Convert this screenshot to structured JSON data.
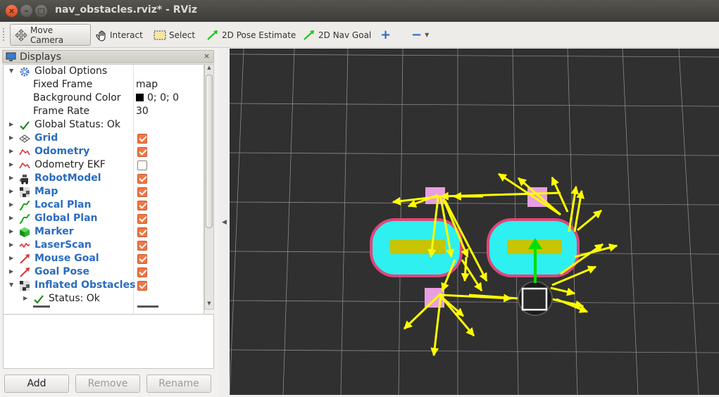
{
  "window": {
    "title": "nav_obstacles.rviz* - RViz",
    "close_glyph": "×",
    "minimize_glyph": "–",
    "maximize_glyph": "□"
  },
  "toolbar": {
    "tools": [
      {
        "label": "Move Camera",
        "icon": "move-camera-icon",
        "active": true
      },
      {
        "label": "Interact",
        "icon": "hand-icon",
        "active": false
      },
      {
        "label": "Select",
        "icon": "select-icon",
        "active": false
      },
      {
        "label": "2D Pose Estimate",
        "icon": "pose-estimate-arrow-icon",
        "active": false
      },
      {
        "label": "2D Nav Goal",
        "icon": "nav-goal-arrow-icon",
        "active": false
      }
    ],
    "add_glyph": "+",
    "remove_glyph": "−"
  },
  "displays": {
    "title": "Displays",
    "close_glyph": "×",
    "rows": [
      {
        "label": "Global Options",
        "icon": "gear-icon",
        "expanded": true,
        "level": 0
      },
      {
        "label": "Fixed Frame",
        "value": "map",
        "level": 1
      },
      {
        "label": "Background Color",
        "value": "0; 0; 0",
        "swatch": "#000000",
        "level": 1
      },
      {
        "label": "Frame Rate",
        "value": "30",
        "level": 1
      },
      {
        "label": "Global Status: Ok",
        "icon": "check-icon",
        "level": 0
      },
      {
        "label": "Grid",
        "icon": "grid-icon",
        "checked": true,
        "level": 0,
        "blue": true
      },
      {
        "label": "Odometry",
        "icon": "odometry-icon",
        "checked": true,
        "level": 0,
        "blue": true
      },
      {
        "label": "Odometry EKF",
        "icon": "odometry-icon",
        "checked": false,
        "level": 0,
        "blue": false
      },
      {
        "label": "RobotModel",
        "icon": "robot-icon",
        "checked": true,
        "level": 0,
        "blue": true
      },
      {
        "label": "Map",
        "icon": "map-icon",
        "checked": true,
        "level": 0,
        "blue": true
      },
      {
        "label": "Local Plan",
        "icon": "path-icon",
        "checked": true,
        "level": 0,
        "blue": true
      },
      {
        "label": "Global Plan",
        "icon": "path-icon",
        "checked": true,
        "level": 0,
        "blue": true
      },
      {
        "label": "Marker",
        "icon": "marker-cube-icon",
        "checked": true,
        "level": 0,
        "blue": true
      },
      {
        "label": "LaserScan",
        "icon": "laser-icon",
        "checked": true,
        "level": 0,
        "blue": true
      },
      {
        "label": "Mouse Goal",
        "icon": "goal-arrow-icon",
        "checked": true,
        "level": 0,
        "blue": true
      },
      {
        "label": "Goal Pose",
        "icon": "goal-arrow-icon",
        "checked": true,
        "level": 0,
        "blue": true
      },
      {
        "label": "Inflated Obstacles",
        "icon": "map-icon",
        "checked": true,
        "level": 0,
        "blue": true,
        "expanded": true
      },
      {
        "label": "Status: Ok",
        "icon": "check-icon",
        "level": 1
      }
    ],
    "buttons": {
      "add": "Add",
      "remove": "Remove",
      "rename": "Rename"
    }
  },
  "colors": {
    "viewport_bg": "#303030",
    "grid": "#8a8a8a",
    "inflation_border": "#e0457a",
    "inflation_fill": "#2ef0f0",
    "obstacle_core": "#c8c400",
    "marker": "#e89fe0",
    "pose_arrow": "#ffff00",
    "robot_heading": "#00e000",
    "robot_body": "#1a1a1a"
  }
}
